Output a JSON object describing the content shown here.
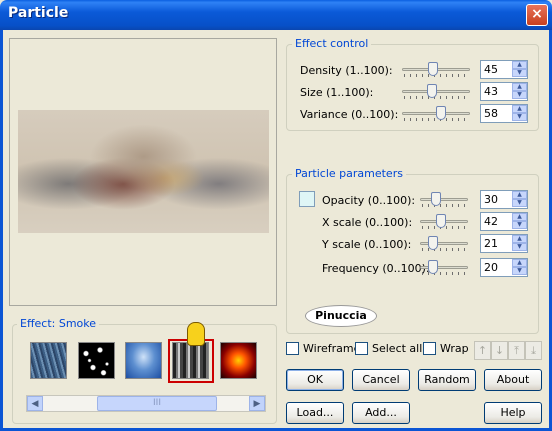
{
  "window": {
    "title": "Particle",
    "close_icon": "×"
  },
  "effect_group": {
    "title": "Effect: Smoke",
    "presets": [
      "rain-preset",
      "starfield-preset",
      "sky-preset",
      "smoke-preset",
      "fire-preset"
    ],
    "selected_index": 3,
    "scroll_grip": "III"
  },
  "effect_control": {
    "title": "Effect control",
    "rows": [
      {
        "label": "Density (1..100):",
        "value": "45",
        "level": 45
      },
      {
        "label": "Size (1..100):",
        "value": "43",
        "level": 43
      },
      {
        "label": "Variance (0..100):",
        "value": "58",
        "level": 58
      }
    ]
  },
  "particle_parameters": {
    "title": "Particle parameters",
    "swatch_color": "#dff6f6",
    "rows": [
      {
        "label": "Opacity (0..100):",
        "value": "30",
        "level": 30
      },
      {
        "label": "X scale (0..100):",
        "value": "42",
        "level": 42
      },
      {
        "label": "Y scale (0..100):",
        "value": "21",
        "level": 21
      },
      {
        "label": "Frequency (0..100):",
        "value": "20",
        "level": 20
      }
    ]
  },
  "watermark": "Pinuccia",
  "checkboxes": {
    "wireframe": "Wireframe",
    "select_all": "Select all",
    "wrap": "Wrap"
  },
  "buttons": {
    "ok": "OK",
    "cancel": "Cancel",
    "random": "Random",
    "about": "About",
    "load": "Load...",
    "add": "Add...",
    "help": "Help"
  },
  "icons": {
    "spin_up": "▲",
    "spin_down": "▼",
    "scroll_left": "◀",
    "scroll_right": "▶",
    "move_top": "⤒",
    "move_down": "↓",
    "move_up": "↑",
    "move_bottom": "⤓"
  }
}
